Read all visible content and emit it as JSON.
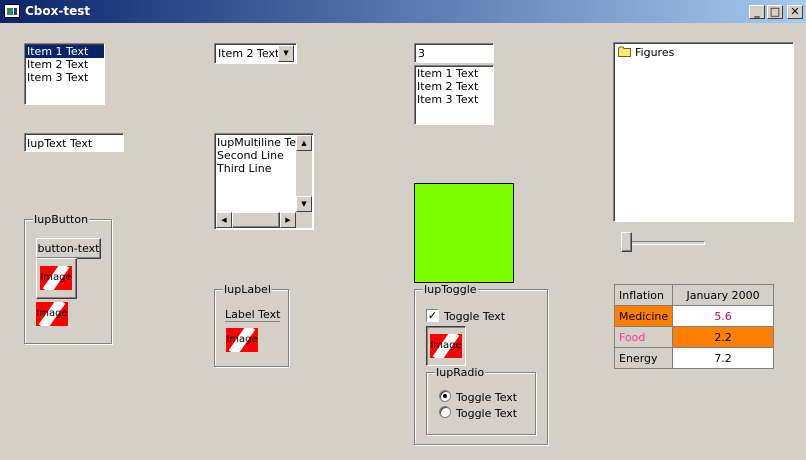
{
  "window": {
    "title": "Cbox-test",
    "min_glyph": "_",
    "max_glyph": "□",
    "close_glyph": "✕"
  },
  "list1": {
    "items": [
      "Item 1 Text",
      "Item 2 Text",
      "Item 3 Text"
    ],
    "selected": "Item 1 Text"
  },
  "dropdown": {
    "value": "Item 2 Text",
    "arrow": "▼"
  },
  "combo": {
    "value": "3",
    "items": [
      "Item 1 Text",
      "Item 2 Text",
      "Item 3 Text"
    ]
  },
  "tree": {
    "root": "Figures"
  },
  "text": {
    "value": "IupText Text"
  },
  "multiline": {
    "lines": [
      "IupMultiline Text",
      "Second Line",
      "Third Line"
    ]
  },
  "iupbutton": {
    "frame_title": "IupButton",
    "button_text": "button-text",
    "image_label": "Image",
    "image_label2": "Image"
  },
  "iuplabel": {
    "frame_title": "IupLabel",
    "label_text": "Label Text",
    "image_label": "Image"
  },
  "iuptoggle": {
    "frame_title": "IupToggle",
    "toggle_text": "Toggle Text",
    "toggle_checked": true,
    "image_label": "Image",
    "radio_title": "IupRadio",
    "radio_options": [
      "Toggle Text",
      "Toggle Text"
    ],
    "radio_selected_index": 0
  },
  "canvas": {
    "color": "#80ff00"
  },
  "slider": {
    "fraction": 0.0
  },
  "matrix": {
    "corner": "Inflation",
    "column_header": "January 2000",
    "rows": [
      {
        "label": "Medicine",
        "value": "5.6",
        "label_bg": "#ff8000",
        "label_color": "#000000",
        "value_bg": "#ffffff",
        "value_color": "#cc0066"
      },
      {
        "label": "Food",
        "value": "2.2",
        "label_bg": "#d4d0c8",
        "label_color": "#ff3399",
        "value_bg": "#ff8000",
        "value_color": "#000000"
      },
      {
        "label": "Energy",
        "value": "7.2",
        "label_bg": "#d4d0c8",
        "label_color": "#000000",
        "value_bg": "#ffffff",
        "value_color": "#000000"
      }
    ]
  },
  "colors": {
    "selection": "#0a246a",
    "face": "#d4d0c8",
    "image_red": "#ff0000"
  }
}
